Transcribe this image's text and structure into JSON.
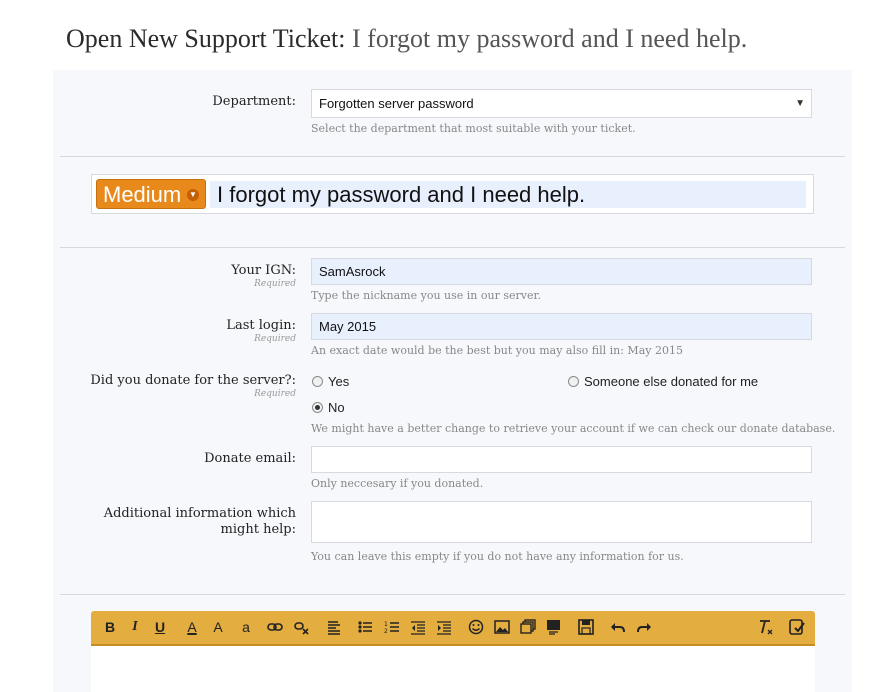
{
  "header": {
    "label": "Open New Support Ticket:",
    "subtitle": "I forgot my password and I need help."
  },
  "department": {
    "label": "Department:",
    "selected": "Forgotten server password",
    "hint": "Select the department that most suitable with your ticket."
  },
  "ticket": {
    "priority": "Medium",
    "title": "I forgot my password and I need help."
  },
  "required_text": "Required",
  "ign": {
    "label": "Your IGN:",
    "value": "SamAsrock",
    "hint": "Type the nickname you use in our server."
  },
  "last_login": {
    "label": "Last login:",
    "value": "May 2015",
    "hint": "An exact date would be the best but you may also fill in: May 2015"
  },
  "donate": {
    "label": "Did you donate for the server?:",
    "options": [
      "Yes",
      "Someone else donated for me",
      "No"
    ],
    "selected": "No",
    "hint": "We might have a better change to retrieve your account if we can check our donate database."
  },
  "donate_email": {
    "label": "Donate email:",
    "value": "",
    "hint": "Only neccesary if you donated."
  },
  "additional": {
    "label_line1": "Additional information which",
    "label_line2": "might help:",
    "value": "",
    "hint": "You can leave this empty if you do not have any information for us."
  },
  "toolbar": {
    "bold": "B",
    "italic": "I",
    "underline": "U",
    "font_color": "A",
    "font_size": "A",
    "case": "a",
    "buttons": [
      "bold-icon",
      "italic-icon",
      "underline-icon",
      "font-color-icon",
      "font-size-icon",
      "text-case-icon",
      "link-icon",
      "unlink-icon",
      "align-icon",
      "bullet-list-icon",
      "numbered-list-icon",
      "outdent-icon",
      "indent-icon",
      "smiley-icon",
      "image-icon",
      "media-icon",
      "quote-icon",
      "save-icon",
      "undo-icon",
      "redo-icon",
      "remove-format-icon",
      "bbcode-toggle-icon"
    ]
  },
  "colors": {
    "priority": "#e8891c",
    "toolbar": "#e3ad3f",
    "autofill": "#e8f0fe"
  }
}
